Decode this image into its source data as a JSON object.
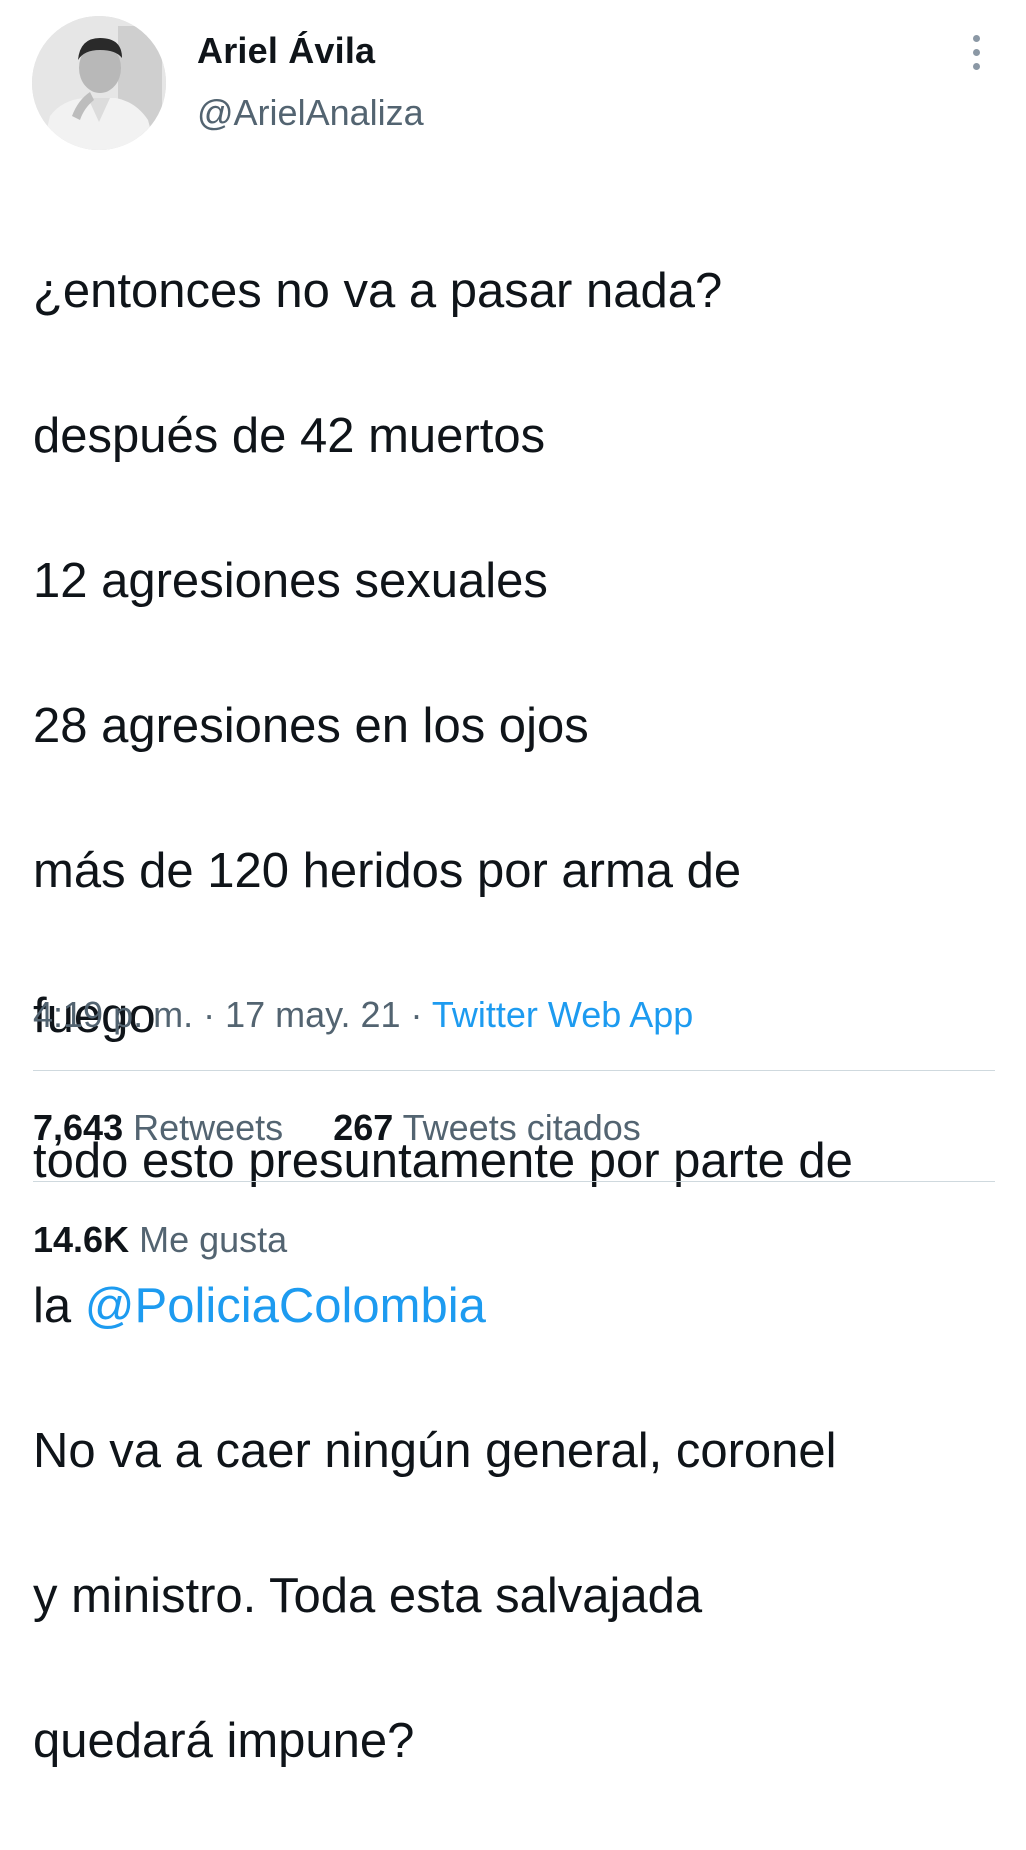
{
  "author": {
    "name": "Ariel Ávila",
    "handle": "@ArielAnaliza"
  },
  "tweet": {
    "lines": [
      "¿entonces no va a pasar nada?",
      "después de 42 muertos",
      "12 agresiones sexuales",
      "28 agresiones en los ojos",
      "más de 120 heridos por arma de",
      "fuego",
      "todo esto presuntamente por parte de"
    ],
    "line8_prefix": "la ",
    "mention": "@PoliciaColombia",
    "lines_after": [
      "No va a caer ningún general, coronel",
      "y ministro. Toda esta salvajada",
      "quedará impune?"
    ]
  },
  "meta": {
    "time": "4:19 p. m.",
    "separator": " · ",
    "date": "17 may. 21",
    "source": "Twitter Web App"
  },
  "stats": {
    "retweets_count": "7,643",
    "retweets_label": "Retweets",
    "quotes_count": "267",
    "quotes_label": "Tweets citados",
    "likes_count": "14.6K",
    "likes_label": "Me gusta"
  },
  "icons": {
    "more": "more-vertical-icon"
  },
  "colors": {
    "link": "#1d9bf0",
    "secondary_text": "#536471",
    "primary_text": "#0f1419",
    "divider": "#cfd9de"
  }
}
